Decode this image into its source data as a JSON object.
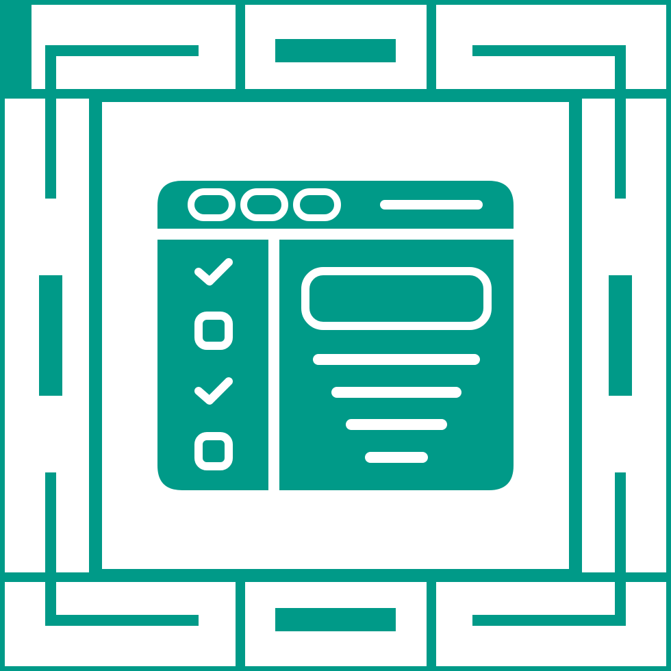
{
  "colors": {
    "primary": "#009a88",
    "background": "#ffffff"
  },
  "icon": {
    "name": "browser-checklist-icon",
    "checklist": [
      {
        "state": "checked",
        "icon": "checkmark-icon"
      },
      {
        "state": "unchecked",
        "icon": "empty-box-icon"
      },
      {
        "state": "checked",
        "icon": "checkmark-icon"
      },
      {
        "state": "unchecked",
        "icon": "empty-box-icon"
      }
    ],
    "window_buttons": 3,
    "content_lines": 4
  },
  "frame": {
    "style": "greek-key-border"
  }
}
